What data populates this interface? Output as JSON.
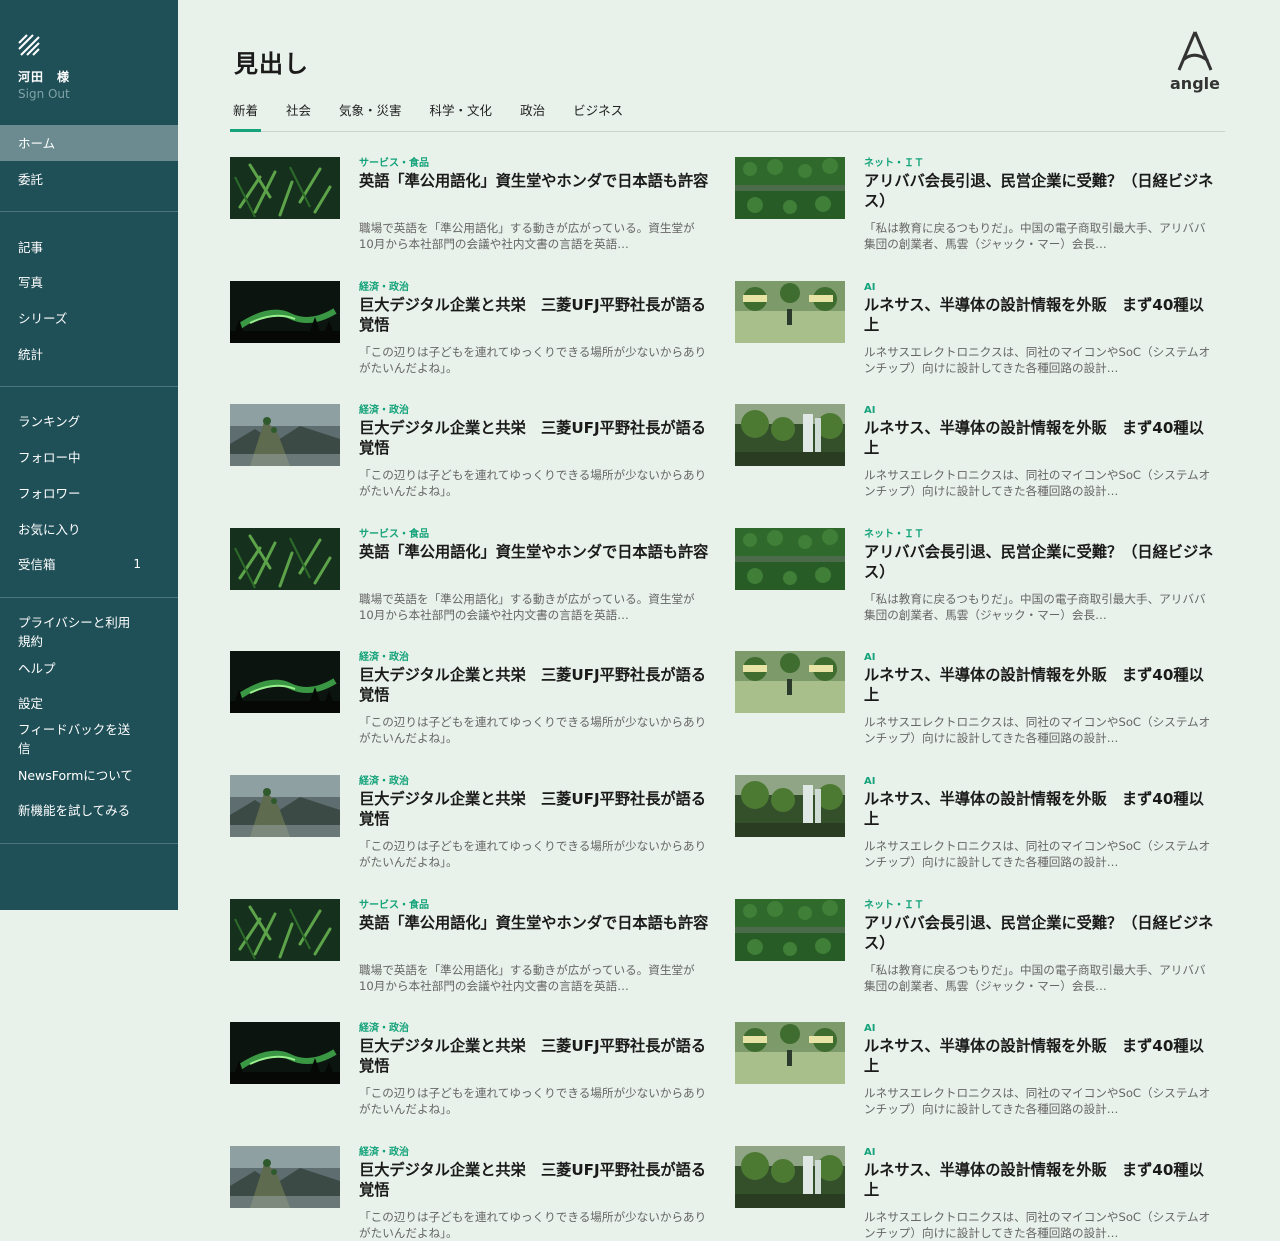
{
  "user": {
    "name": "河田　様",
    "sign_out": "Sign Out"
  },
  "sidebar": {
    "groups": [
      {
        "items": [
          {
            "label": "ホーム",
            "active": true
          },
          {
            "label": "委託"
          }
        ]
      },
      {
        "items": [
          {
            "label": "記事"
          },
          {
            "label": "写真"
          },
          {
            "label": "シリーズ"
          },
          {
            "label": "統計"
          }
        ]
      },
      {
        "items": [
          {
            "label": "ランキング"
          },
          {
            "label": "フォロー中"
          },
          {
            "label": "フォロワー"
          },
          {
            "label": "お気に入り"
          },
          {
            "label": "受信箱",
            "badge": "1"
          }
        ]
      },
      {
        "items": [
          {
            "label": "プライバシーと利用規約"
          },
          {
            "label": "ヘルプ"
          },
          {
            "label": "設定"
          },
          {
            "label": "フィードバックを送信"
          },
          {
            "label": "NewsFormについて"
          },
          {
            "label": "新機能を試してみる"
          }
        ]
      }
    ]
  },
  "page": {
    "title": "見出し",
    "logo_text": "angle"
  },
  "tabs": [
    "新着",
    "社会",
    "気象・災害",
    "科学・文化",
    "政治",
    "ビジネス"
  ],
  "articles": [
    {
      "thumb": "bamboo",
      "category": "サービス・食品",
      "headline": "英語「準公用語化」資生堂やホンダで日本語も許容",
      "summary": "職場で英語を「準公用語化」する動きが広がっている。資生堂が10月から本社部門の会議や社内文書の言語を英語…"
    },
    {
      "thumb": "forest",
      "category": "ネット・ＩＴ",
      "headline": "アリババ会長引退、民営企業に受難？（日経ビジネス）",
      "summary": "「私は教育に戻るつもりだ」。中国の電子商取引最大手、アリババ集団の創業者、馬雲（ジャック・マー）会長…"
    },
    {
      "thumb": "aurora",
      "category": "経済・政治",
      "headline": "巨大デジタル企業と共栄　三菱UFJ平野社長が語る覚悟",
      "summary": "「この辺りは子どもを連れてゆっくりできる場所が少ないからありがたいんだよね」。"
    },
    {
      "thumb": "field",
      "category": "AI",
      "headline": "ルネサス、半導体の設計情報を外販　まず40種以上",
      "summary": "ルネサスエレクトロニクスは、同社のマイコンやSoC（システムオンチップ）向けに設計してきた各種回路の設計…"
    },
    {
      "thumb": "mountain",
      "category": "経済・政治",
      "headline": "巨大デジタル企業と共栄　三菱UFJ平野社長が語る覚悟",
      "summary": "「この辺りは子どもを連れてゆっくりできる場所が少ないからありがたいんだよね」。"
    },
    {
      "thumb": "waterfall",
      "category": "AI",
      "headline": "ルネサス、半導体の設計情報を外販　まず40種以上",
      "summary": "ルネサスエレクトロニクスは、同社のマイコンやSoC（システムオンチップ）向けに設計してきた各種回路の設計…"
    },
    {
      "thumb": "bamboo",
      "category": "サービス・食品",
      "headline": "英語「準公用語化」資生堂やホンダで日本語も許容",
      "summary": "職場で英語を「準公用語化」する動きが広がっている。資生堂が10月から本社部門の会議や社内文書の言語を英語…"
    },
    {
      "thumb": "forest",
      "category": "ネット・ＩＴ",
      "headline": "アリババ会長引退、民営企業に受難？（日経ビジネス）",
      "summary": "「私は教育に戻るつもりだ」。中国の電子商取引最大手、アリババ集団の創業者、馬雲（ジャック・マー）会長…"
    },
    {
      "thumb": "aurora",
      "category": "経済・政治",
      "headline": "巨大デジタル企業と共栄　三菱UFJ平野社長が語る覚悟",
      "summary": "「この辺りは子どもを連れてゆっくりできる場所が少ないからありがたいんだよね」。"
    },
    {
      "thumb": "field",
      "category": "AI",
      "headline": "ルネサス、半導体の設計情報を外販　まず40種以上",
      "summary": "ルネサスエレクトロニクスは、同社のマイコンやSoC（システムオンチップ）向けに設計してきた各種回路の設計…"
    },
    {
      "thumb": "mountain",
      "category": "経済・政治",
      "headline": "巨大デジタル企業と共栄　三菱UFJ平野社長が語る覚悟",
      "summary": "「この辺りは子どもを連れてゆっくりできる場所が少ないからありがたいんだよね」。"
    },
    {
      "thumb": "waterfall",
      "category": "AI",
      "headline": "ルネサス、半導体の設計情報を外販　まず40種以上",
      "summary": "ルネサスエレクトロニクスは、同社のマイコンやSoC（システムオンチップ）向けに設計してきた各種回路の設計…"
    },
    {
      "thumb": "bamboo",
      "category": "サービス・食品",
      "headline": "英語「準公用語化」資生堂やホンダで日本語も許容",
      "summary": "職場で英語を「準公用語化」する動きが広がっている。資生堂が10月から本社部門の会議や社内文書の言語を英語…"
    },
    {
      "thumb": "forest",
      "category": "ネット・ＩＴ",
      "headline": "アリババ会長引退、民営企業に受難？（日経ビジネス）",
      "summary": "「私は教育に戻るつもりだ」。中国の電子商取引最大手、アリババ集団の創業者、馬雲（ジャック・マー）会長…"
    },
    {
      "thumb": "aurora",
      "category": "経済・政治",
      "headline": "巨大デジタル企業と共栄　三菱UFJ平野社長が語る覚悟",
      "summary": "「この辺りは子どもを連れてゆっくりできる場所が少ないからありがたいんだよね」。"
    },
    {
      "thumb": "field",
      "category": "AI",
      "headline": "ルネサス、半導体の設計情報を外販　まず40種以上",
      "summary": "ルネサスエレクトロニクスは、同社のマイコンやSoC（システムオンチップ）向けに設計してきた各種回路の設計…"
    },
    {
      "thumb": "mountain",
      "category": "経済・政治",
      "headline": "巨大デジタル企業と共栄　三菱UFJ平野社長が語る覚悟",
      "summary": "「この辺りは子どもを連れてゆっくりできる場所が少ないからありがたいんだよね」。"
    },
    {
      "thumb": "waterfall",
      "category": "AI",
      "headline": "ルネサス、半導体の設計情報を外販　まず40種以上",
      "summary": "ルネサスエレクトロニクスは、同社のマイコンやSoC（システムオンチップ）向けに設計してきた各種回路の設計…"
    }
  ]
}
